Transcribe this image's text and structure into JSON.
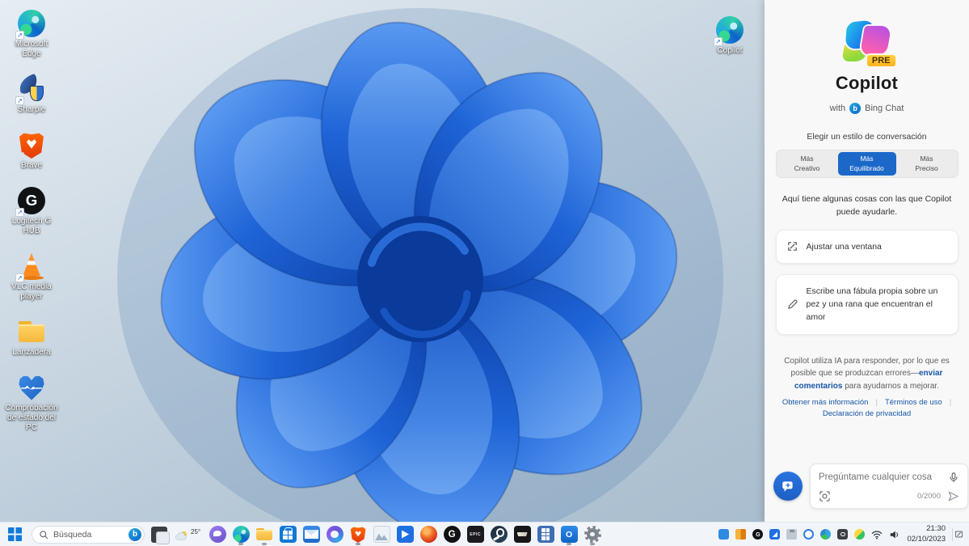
{
  "desktop": {
    "icons": [
      {
        "label": "Microsoft Edge",
        "icon": "edge",
        "shortcut": true
      },
      {
        "label": "Sharpie",
        "icon": "bird-shield",
        "shortcut": true
      },
      {
        "label": "Brave",
        "icon": "brave",
        "shortcut": true
      },
      {
        "label": "Logitech G HUB",
        "icon": "ghub",
        "shortcut": true
      },
      {
        "label": "VLC media player",
        "icon": "vlc",
        "shortcut": true
      },
      {
        "label": "Lanzadera",
        "icon": "folder",
        "shortcut": false
      },
      {
        "label": "Comprobación de estado del PC",
        "icon": "pc-health",
        "shortcut": true
      }
    ],
    "right_icon": {
      "label": "Copilot",
      "icon": "edge",
      "shortcut": true
    }
  },
  "copilot": {
    "pre_badge": "PRE",
    "title": "Copilot",
    "subtitle_prefix": "with",
    "subtitle_brand": "Bing Chat",
    "style_heading": "Elegir un estilo de conversación",
    "styles": [
      {
        "line1": "Más",
        "line2": "Creativo",
        "selected": false
      },
      {
        "line1": "Más",
        "line2": "Equilibrado",
        "selected": true
      },
      {
        "line1": "Más",
        "line2": "Preciso",
        "selected": false
      }
    ],
    "intro": "Aquí tiene algunas cosas con las que Copilot puede ayudarle.",
    "suggestions": [
      {
        "icon": "adjust-window",
        "text": "Ajustar una ventana"
      },
      {
        "icon": "pencil",
        "text": "Escribe una fábula propia sobre un pez y una rana que encuentran el amor"
      }
    ],
    "disclaimer_pre": "Copilot utiliza IA para responder, por lo que es posible que se produzcan errores—",
    "disclaimer_link": "enviar comentarios",
    "disclaimer_post": " para ayudarnos a mejorar.",
    "links": [
      "Obtener más información",
      "Términos de uso",
      "Declaración de privacidad"
    ],
    "input": {
      "placeholder": "Pregúntame cualquier cosa",
      "counter": "0/2000"
    }
  },
  "taskbar": {
    "search_placeholder": "Búsqueda",
    "weather_temp": "25°",
    "apps": [
      {
        "icon": "chat",
        "running": false
      },
      {
        "icon": "edge",
        "running": true
      },
      {
        "icon": "file-explorer",
        "running": true
      },
      {
        "icon": "store",
        "running": false
      },
      {
        "icon": "mail",
        "running": false
      },
      {
        "icon": "cortana",
        "running": false
      },
      {
        "icon": "brave",
        "running": true
      },
      {
        "icon": "photos",
        "running": false
      },
      {
        "icon": "movies",
        "running": false
      },
      {
        "icon": "game-red",
        "running": false
      },
      {
        "icon": "ghub",
        "running": false
      },
      {
        "icon": "epic",
        "running": false
      },
      {
        "icon": "steam",
        "running": false
      },
      {
        "icon": "game-black",
        "running": false
      },
      {
        "icon": "calculator",
        "running": false
      },
      {
        "icon": "outlook",
        "running": true
      },
      {
        "icon": "settings",
        "running": true
      }
    ],
    "tray": [
      "tray-blue",
      "tray-orange",
      "tray-ghub",
      "tray-bluesq",
      "usb",
      "bluetooth",
      "globe",
      "capture",
      "tray-yellow",
      "wifi",
      "volume"
    ],
    "clock": {
      "time": "21:30",
      "date": "02/10/2023"
    }
  },
  "colors": {
    "copilot_accent": "#1b68c9",
    "link_blue": "#1857a8",
    "pre_badge_yellow": "#ffc83d",
    "taskbar_bg": "#f1f5fa",
    "start_blue": "#0f7ad8",
    "wallpaper_blue": "#1e63d6"
  }
}
